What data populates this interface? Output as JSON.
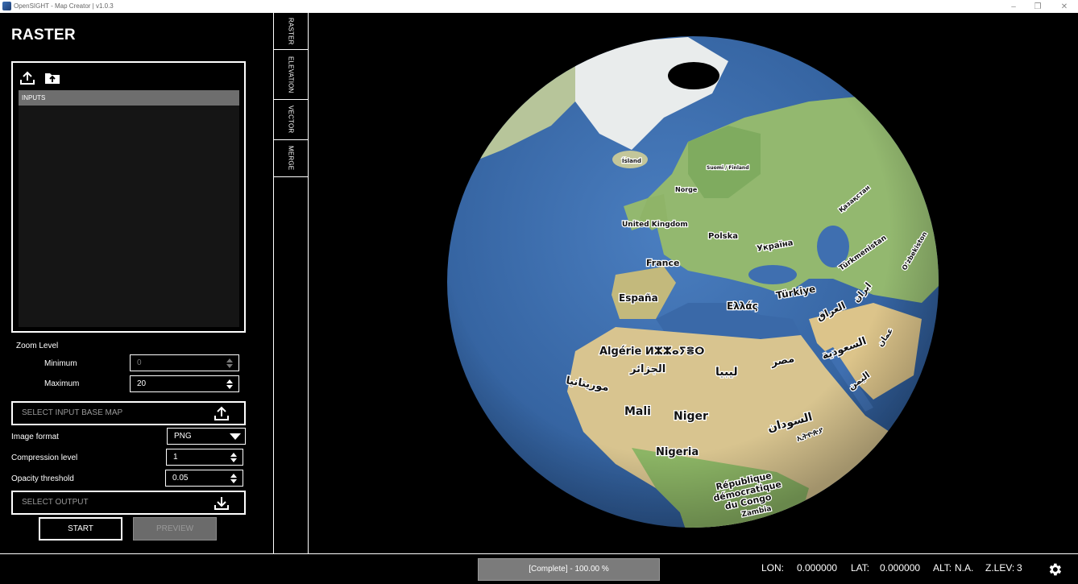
{
  "window": {
    "title": "OpenSIGHT - Map Creator | v1.0.3",
    "minimize": "–",
    "maximize": "❐",
    "close": "✕"
  },
  "panel": {
    "title": "RASTER",
    "inputs_header": "INPUTS",
    "zoom_level_label": "Zoom Level",
    "minimum_label": "Minimum",
    "minimum_value": "0",
    "maximum_label": "Maximum",
    "maximum_value": "20",
    "select_base_map": "SELECT INPUT BASE MAP",
    "image_format_label": "Image format",
    "image_format_value": "PNG",
    "compression_label": "Compression level",
    "compression_value": "1",
    "opacity_label": "Opacity threshold",
    "opacity_value": "0.05",
    "select_output": "SELECT OUTPUT",
    "start_label": "START",
    "preview_label": "PREVIEW"
  },
  "tabs": [
    {
      "label": "RASTER",
      "active": true
    },
    {
      "label": "ELEVATION",
      "active": false
    },
    {
      "label": "VECTOR",
      "active": false
    },
    {
      "label": "MERGE",
      "active": false
    }
  ],
  "map": {
    "labels": {
      "island": "Ísland",
      "suomi": "Suomi / Finland",
      "norge": "Norge",
      "kazakhstan": "Қазақстан",
      "united_kingdom": "United Kingdom",
      "polska": "Polska",
      "ukraine": "Україна",
      "turkmenistan": "Türkmenistan",
      "uzbekistan": "Oʻzbekiston",
      "france": "France",
      "espana": "España",
      "ellas": "Ελλάς",
      "turkiye": "Türkiye",
      "iran": "ایران",
      "iraq": "العراق",
      "oman": "عمان",
      "algerie": "Algérie ⵍⵣⵣⴰⵢⴻⵔ",
      "algeria_ar": "الجزائر",
      "libya": "ليبيا",
      "egypt": "مصر",
      "saudi": "السعودية",
      "yemen": "اليمن",
      "mauritania": "موريتانيا",
      "mali": "Mali",
      "niger": "Niger",
      "sudan": "السودان",
      "ethiopia": "ኢትዮጵያ",
      "nigeria": "Nigeria",
      "rdc_1": "République",
      "rdc_2": "démocratique",
      "rdc_3": "du Congo",
      "zambia": "Zambia"
    }
  },
  "status": {
    "progress_text": "[Complete] - 100.00 %",
    "progress_value": 1.0,
    "lon_label": "LON:",
    "lon_value": "0.000000",
    "lat_label": "LAT:",
    "lat_value": "0.000000",
    "alt_label": "ALT:",
    "alt_value": "N.A.",
    "zlev_label": "Z.LEV:",
    "zlev_value": "3"
  },
  "colors": {
    "ocean": "#3f6fb0",
    "land": "#a9c47a",
    "background": "#000000",
    "progress": "#7b7b7b"
  }
}
